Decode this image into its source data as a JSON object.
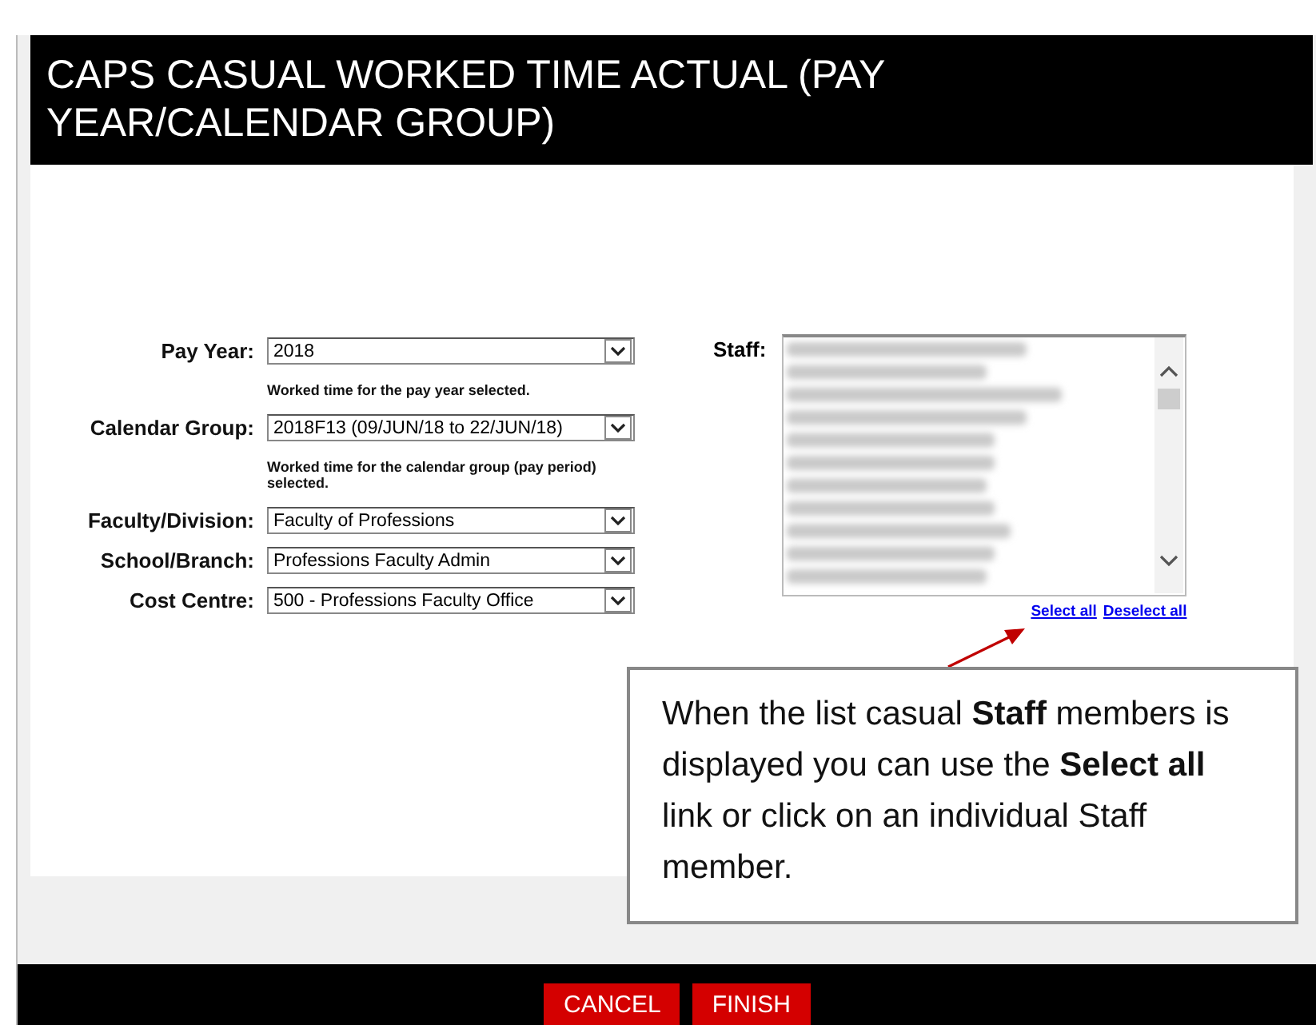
{
  "dialog": {
    "title": "CAPS CASUAL WORKED TIME ACTUAL (PAY YEAR/CALENDAR GROUP)"
  },
  "fields": [
    {
      "label": "Pay Year:",
      "value": "2018",
      "hint": "Worked time for the pay year selected."
    },
    {
      "label": "Calendar Group:",
      "value": "2018F13 (09/JUN/18 to 22/JUN/18)",
      "hint": "Worked time for the calendar group (pay period) selected."
    },
    {
      "label": "Faculty/Division:",
      "value": "Faculty of Professions"
    },
    {
      "label": "School/Branch:",
      "value": "Professions Faculty Admin"
    },
    {
      "label": "Cost Centre:",
      "value": "500 - Professions Faculty Office"
    }
  ],
  "staff": {
    "label": "Staff:",
    "links": [
      "Select all",
      "Deselect all"
    ]
  },
  "callout": {
    "text": "When the list casual **Staff** members is displayed you can use the **Select all** link or click on an individual Staff member."
  },
  "buttons": [
    "CANCEL",
    "FINISH"
  ]
}
